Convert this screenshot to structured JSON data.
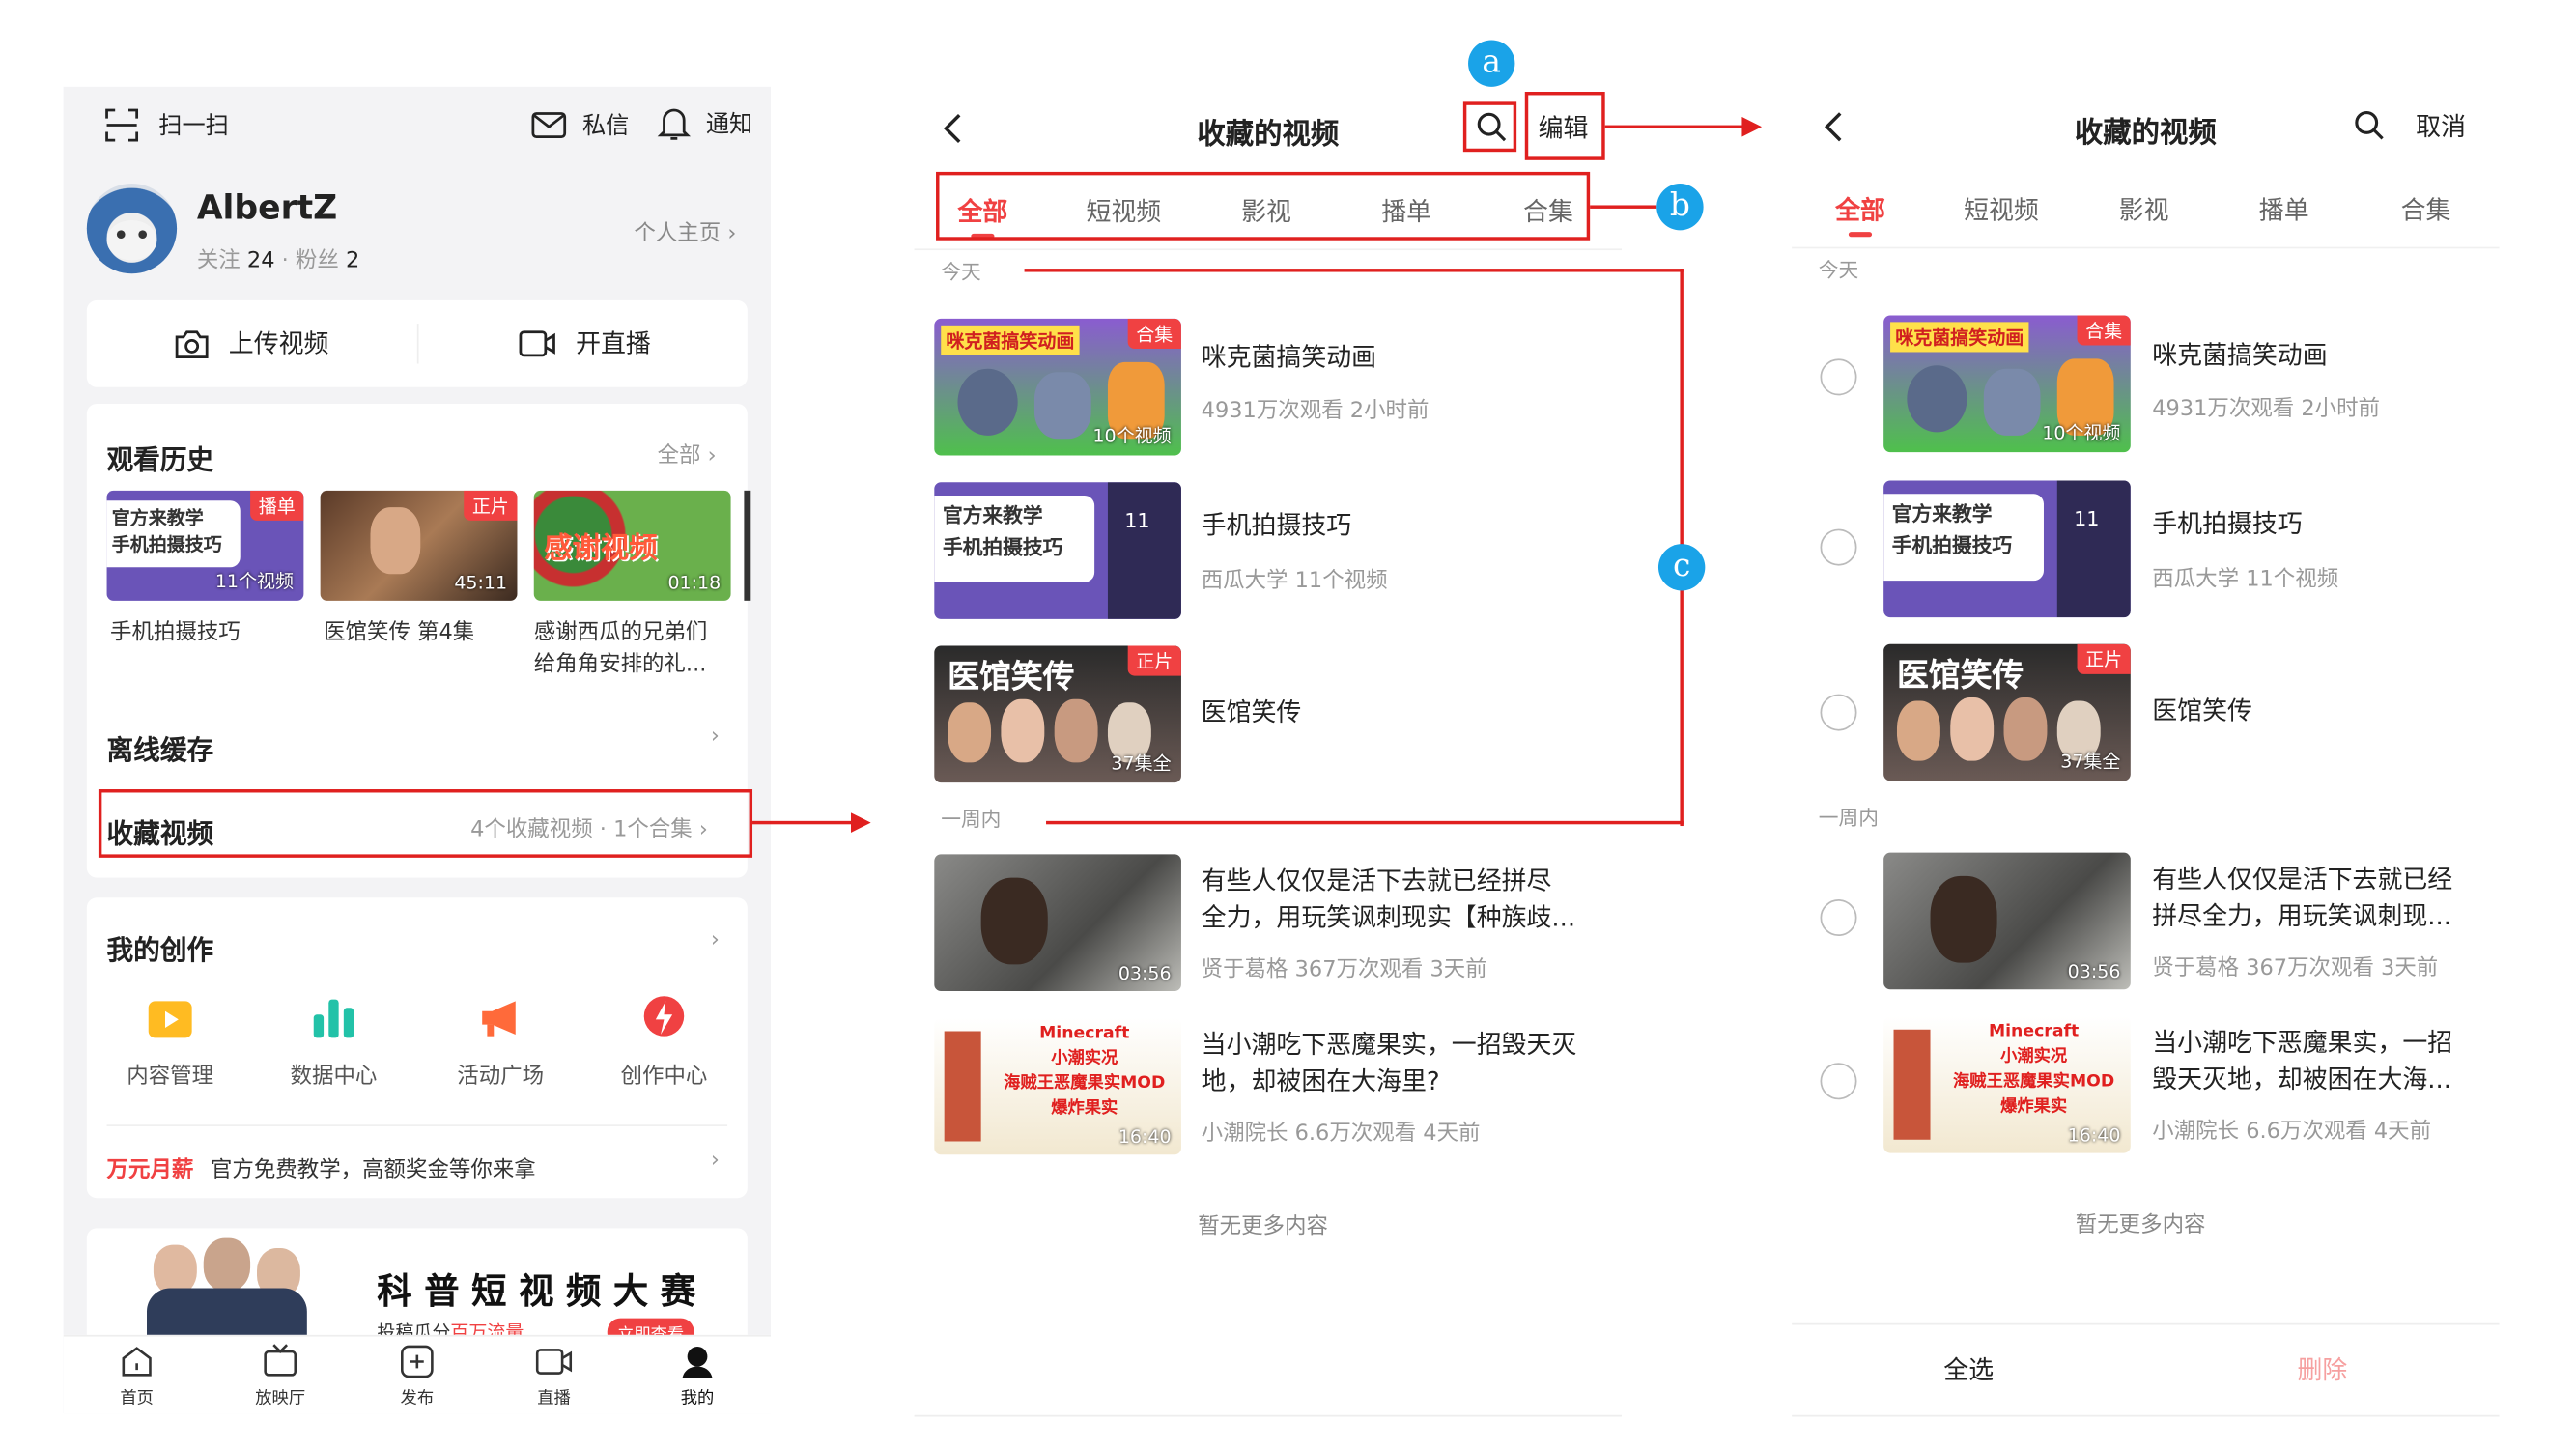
{
  "colors": {
    "accent": "#f04142",
    "annotation_red": "#e0201f",
    "annotation_blue": "#1aa3e8"
  },
  "s1": {
    "scan": "扫一扫",
    "message": "私信",
    "notify": "通知",
    "username": "AlbertZ",
    "follow_label": "关注",
    "follow_count": "24",
    "fans_label": "· 粉丝",
    "fans_count": "2",
    "profile_link": "个人主页",
    "upload": "上传视频",
    "live": "开直播",
    "history": {
      "title": "观看历史",
      "all": "全部",
      "items": [
        {
          "caption": "手机拍摄技巧",
          "badge": "播单",
          "dur": "11个视频",
          "art": "官方来教学\n手机拍摄技巧"
        },
        {
          "caption": "医馆笑传 第4集",
          "badge": "正片",
          "dur": "45:11"
        },
        {
          "caption": "感谢西瓜的兄弟们\n给角角安排的礼...",
          "dur": "01:18",
          "art": "感谢视频"
        }
      ]
    },
    "offline": "离线缓存",
    "fav": {
      "title": "收藏视频",
      "info": "4个收藏视频 · 1个合集"
    },
    "creation": {
      "title": "我的创作",
      "items": [
        "内容管理",
        "数据中心",
        "活动广场",
        "创作中心"
      ]
    },
    "promo": {
      "tag": "万元月薪",
      "text": "官方免费教学，高额奖金等你来拿"
    },
    "banner": {
      "title": "科 普 短 视 频 大 赛",
      "sub": "投稿瓜分",
      "sub_red": "百万流量",
      "btn": "立即查看"
    },
    "tabbar": [
      "首页",
      "放映厅",
      "发布",
      "直播",
      "我的"
    ]
  },
  "s2": {
    "title": "收藏的视频",
    "edit": "编辑",
    "tabs": [
      "全部",
      "短视频",
      "影视",
      "播单",
      "合集"
    ],
    "today": "今天",
    "week": "一周内",
    "rows": [
      {
        "title": "咪克菌搞笑动画",
        "sub": "4931万次观看  2小时前",
        "badge": "合集",
        "dur": "10个视频",
        "art": "咪克菌搞笑动画"
      },
      {
        "title": "手机拍摄技巧",
        "sub": "西瓜大学  11个视频",
        "count": "11",
        "art": "官方来教学\n手机拍摄技巧"
      },
      {
        "title": "医馆笑传",
        "badge": "正片",
        "dur": "37集全",
        "art": "医馆笑传"
      },
      {
        "title": "有些人仅仅是活下去就已经拼尽\n全力，用玩笑讽刺现实【种族歧...",
        "sub": "贤于葛格  367万次观看  3天前",
        "dur": "03:56"
      },
      {
        "title": "当小潮吃下恶魔果实，一招毁天灭\n地，却被困在大海里?",
        "sub": "小潮院长  6.6万次观看  4天前",
        "dur": "16:40",
        "art": "Minecraft\n小潮实况\n海贼王恶魔果实MOD\n爆炸果实"
      }
    ],
    "no_more": "暂无更多内容"
  },
  "s3": {
    "title": "收藏的视频",
    "cancel": "取消",
    "tabs": [
      "全部",
      "短视频",
      "影视",
      "播单",
      "合集"
    ],
    "today": "今天",
    "week": "一周内",
    "rows": [
      {
        "title": "咪克菌搞笑动画",
        "sub": "4931万次观看  2小时前",
        "badge": "合集",
        "dur": "10个视频",
        "art": "咪克菌搞笑动画"
      },
      {
        "title": "手机拍摄技巧",
        "sub": "西瓜大学  11个视频",
        "count": "11",
        "art": "官方来教学\n手机拍摄技巧"
      },
      {
        "title": "医馆笑传",
        "badge": "正片",
        "dur": "37集全",
        "art": "医馆笑传"
      },
      {
        "title": "有些人仅仅是活下去就已经\n拼尽全力，用玩笑讽刺现...",
        "sub": "贤于葛格  367万次观看  3天前",
        "dur": "03:56"
      },
      {
        "title": "当小潮吃下恶魔果实，一招\n毁天灭地，却被困在大海...",
        "sub": "小潮院长  6.6万次观看  4天前",
        "dur": "16:40",
        "art": "Minecraft\n小潮实况\n海贼王恶魔果实MOD\n爆炸果实"
      }
    ],
    "no_more": "暂无更多内容",
    "select_all": "全选",
    "delete": "删除"
  },
  "annotations": {
    "a": "a",
    "b": "b",
    "c": "c"
  }
}
